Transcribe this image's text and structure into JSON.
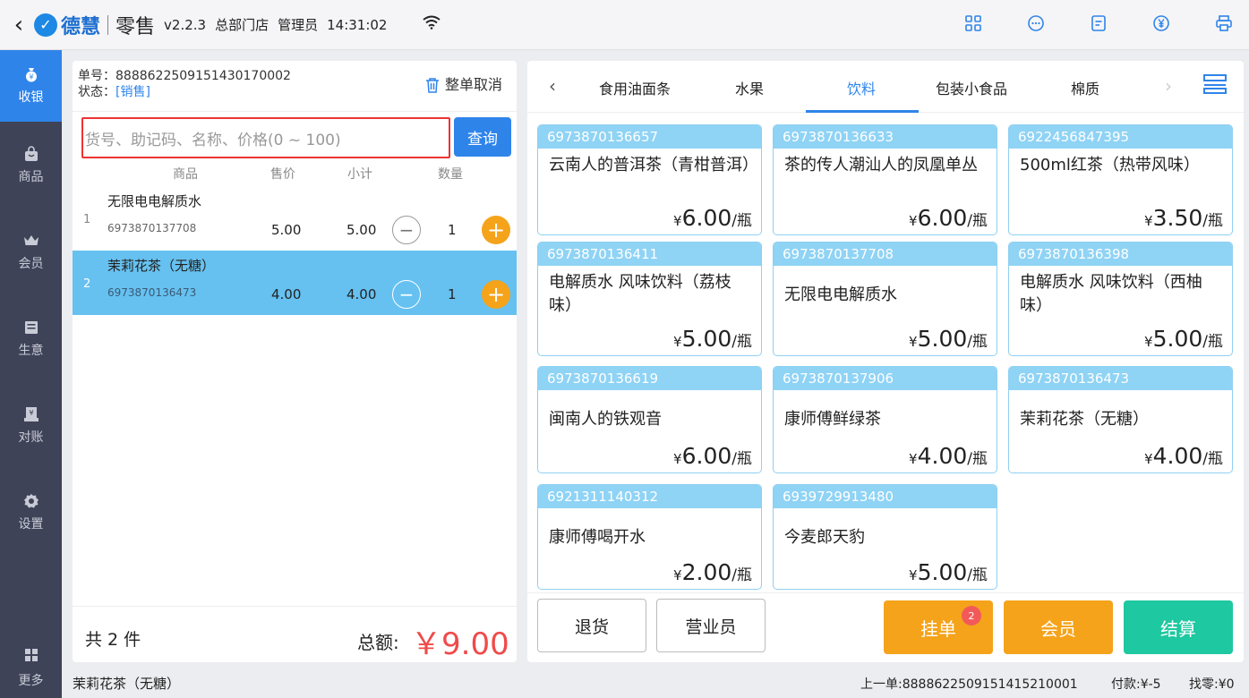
{
  "header": {
    "brand": "德慧",
    "app_name": "零售",
    "version": "v2.2.3",
    "store": "总部门店",
    "role": "管理员",
    "time": "14:31:02"
  },
  "nav": {
    "items": [
      {
        "label": "收银",
        "icon": "money-bag-icon"
      },
      {
        "label": "商品",
        "icon": "bag-icon"
      },
      {
        "label": "会员",
        "icon": "crown-icon"
      },
      {
        "label": "生意",
        "icon": "report-icon"
      },
      {
        "label": "对账",
        "icon": "ledger-icon"
      },
      {
        "label": "设置",
        "icon": "gear-icon"
      }
    ],
    "more_label": "更多"
  },
  "order": {
    "order_no_label": "单号：",
    "order_no": "8888622509151430170002",
    "status_label": "状态：",
    "status_value": "[销售]",
    "cancel_all_label": "整单取消",
    "search_placeholder": "货号、助记码、名称、价格(0 ~ 100)",
    "query_label": "查询",
    "columns": {
      "product": "商品",
      "price": "售价",
      "subtotal": "小计",
      "qty": "数量"
    },
    "items": [
      {
        "idx": "1",
        "name": "无限电电解质水",
        "code": "6973870137708",
        "price": "5.00",
        "subtotal": "5.00",
        "qty": "1"
      },
      {
        "idx": "2",
        "name": "茉莉花茶（无糖）",
        "code": "6973870136473",
        "price": "4.00",
        "subtotal": "4.00",
        "qty": "1"
      }
    ],
    "count_text": "共 2 件",
    "total_label": "总额:",
    "total_value": "￥9.00"
  },
  "categories": {
    "tabs": [
      "食用油面条",
      "水果",
      "饮料",
      "包装小食品",
      "棉质"
    ],
    "active": "饮料"
  },
  "products": [
    {
      "code": "6973870136657",
      "name": "云南人的普洱茶（青柑普洱）",
      "currency": "¥",
      "price": "6.00",
      "unit": "/瓶"
    },
    {
      "code": "6973870136633",
      "name": "茶的传人潮汕人的凤凰单丛",
      "currency": "¥",
      "price": "6.00",
      "unit": "/瓶"
    },
    {
      "code": "6922456847395",
      "name": "500ml红茶（热带风味）",
      "currency": "¥",
      "price": "3.50",
      "unit": "/瓶"
    },
    {
      "code": "6973870136411",
      "name": "电解质水 风味饮料（荔枝味）",
      "currency": "¥",
      "price": "5.00",
      "unit": "/瓶"
    },
    {
      "code": "6973870137708",
      "name": "无限电电解质水",
      "currency": "¥",
      "price": "5.00",
      "unit": "/瓶"
    },
    {
      "code": "6973870136398",
      "name": "电解质水 风味饮料（西柚味）",
      "currency": "¥",
      "price": "5.00",
      "unit": "/瓶"
    },
    {
      "code": "6973870136619",
      "name": "闽南人的铁观音",
      "currency": "¥",
      "price": "6.00",
      "unit": "/瓶"
    },
    {
      "code": "6973870137906",
      "name": "康师傅鲜绿茶",
      "currency": "¥",
      "price": "4.00",
      "unit": "/瓶"
    },
    {
      "code": "6973870136473",
      "name": "茉莉花茶（无糖）",
      "currency": "¥",
      "price": "4.00",
      "unit": "/瓶"
    },
    {
      "code": "6921311140312",
      "name": "康师傅喝开水",
      "currency": "¥",
      "price": "2.00",
      "unit": "/瓶"
    },
    {
      "code": "6939729913480",
      "name": "今麦郎天豹",
      "currency": "¥",
      "price": "5.00",
      "unit": "/瓶"
    }
  ],
  "actions": {
    "return_label": "退货",
    "clerk_label": "营业员",
    "hold_label": "挂单",
    "hold_badge": "2",
    "member_label": "会员",
    "checkout_label": "结算"
  },
  "statusbar": {
    "current_item": "茉莉花茶（无糖）",
    "last_order": "上一单:8888622509151415210001",
    "paid": "付款:¥-5",
    "change": "找零:¥0"
  },
  "colors": {
    "accent": "#2f84ea",
    "nav_bg": "#3f4358",
    "hold": "#f5a31a",
    "member": "#f5a31a",
    "checkout": "#1ec8a0",
    "total": "#f04a4a"
  }
}
